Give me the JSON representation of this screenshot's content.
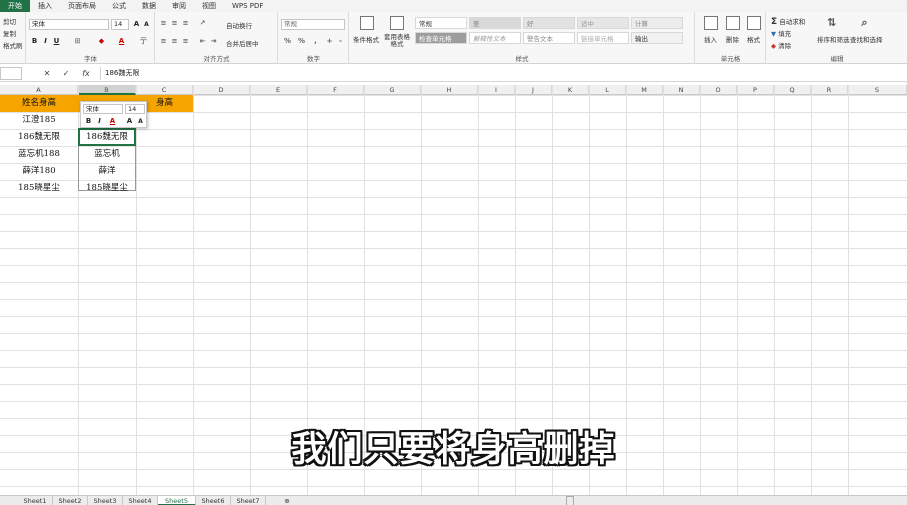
{
  "ribbon": {
    "tabs": [
      "开始",
      "插入",
      "页面布局",
      "公式",
      "数据",
      "审阅",
      "视图",
      "WPS PDF"
    ],
    "clipboard": {
      "cut": "剪切",
      "copy": "复制",
      "painter": "格式刷"
    },
    "font": {
      "name": "宋体",
      "size": "14",
      "label": "字体",
      "bold": "B",
      "italic": "I",
      "underline": "U"
    },
    "align": {
      "wrap": "自动换行",
      "merge": "合并后居中",
      "label": "对齐方式"
    },
    "number": {
      "format": "常规",
      "label": "数字"
    },
    "styles": {
      "cond_fmt": "条件格式",
      "table_fmt": "套用表格格式",
      "cells": [
        "常规",
        "差",
        "好",
        "适中",
        "计算",
        "检查单元格",
        "解释性文本",
        "警告文本",
        "链接单元格",
        "输出"
      ],
      "label": "样式"
    },
    "cells_group": {
      "insert": "插入",
      "delete": "删除",
      "format": "格式",
      "label": "单元格"
    },
    "editing": {
      "autosum": "自动求和",
      "fill": "填充",
      "clear": "清除",
      "sort": "排序和筛选",
      "find": "查找和选择",
      "label": "编辑"
    }
  },
  "formula_bar": {
    "content": "186魏无限"
  },
  "columns": [
    "A",
    "B",
    "C",
    "D",
    "E",
    "F",
    "G",
    "H",
    "I",
    "J",
    "K",
    "L",
    "M",
    "N",
    "O",
    "P",
    "Q",
    "R",
    "S"
  ],
  "cells": {
    "a1": "姓名身高",
    "c1": "身高",
    "a2": "江澄185",
    "a3": "186魏无限",
    "a4": "蓝忘机188",
    "a5": "薛洋180",
    "a6": "185晓星尘",
    "b2": "186魏无限",
    "b3": "蓝忘机",
    "b4": "薛洋",
    "b5": "185晓星尘"
  },
  "mini_toolbar": {
    "font": "宋体",
    "size": "14"
  },
  "sheets": [
    "Sheet1",
    "Sheet2",
    "Sheet3",
    "Sheet4",
    "Sheet5",
    "Sheet6",
    "Sheet7"
  ],
  "active_sheet": "Sheet5",
  "subtitle": "我们只要将身高删掉",
  "colors": {
    "accent": "#217346",
    "header_fill": "#f5a400"
  }
}
